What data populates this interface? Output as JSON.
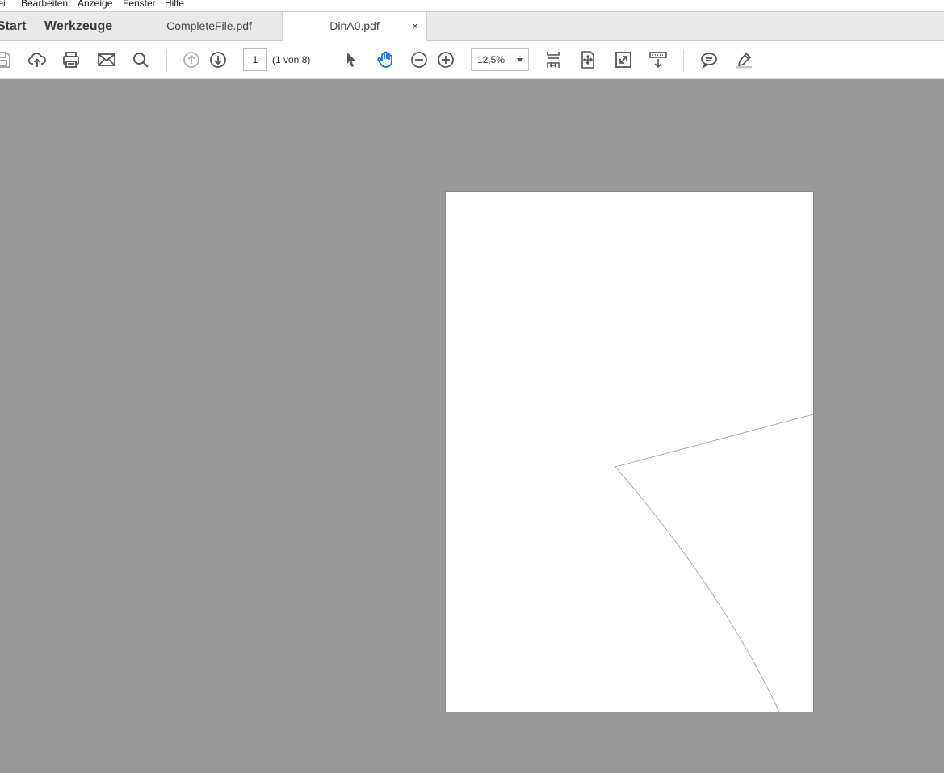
{
  "menu": {
    "items": [
      "tei",
      "Bearbeiten",
      "Anzeige",
      "Fenster",
      "Hilfe"
    ]
  },
  "tabs": {
    "home": "Start",
    "tools": "Werkzeuge",
    "documents": [
      {
        "label": "CompleteFile.pdf",
        "active": false
      },
      {
        "label": "DinA0.pdf",
        "active": true,
        "close": "×"
      }
    ]
  },
  "toolbar": {
    "icons": [
      "save-icon",
      "cloud-upload-icon",
      "print-icon",
      "email-icon",
      "search-icon",
      "previous-page-icon",
      "next-page-icon",
      "select-arrow-icon",
      "hand-tool-icon",
      "zoom-out-icon",
      "zoom-in-icon",
      "fit-width-icon",
      "fit-page-icon",
      "full-screen-icon",
      "scroll-mode-icon",
      "comment-icon",
      "highlight-pen-icon"
    ],
    "current_page": "1",
    "page_count_text": "(1 von 8)",
    "zoom": "12,5%",
    "active_tool_color": "#1473e6"
  },
  "viewer": {
    "background_color": "#999999",
    "page_color": "#ffffff"
  }
}
